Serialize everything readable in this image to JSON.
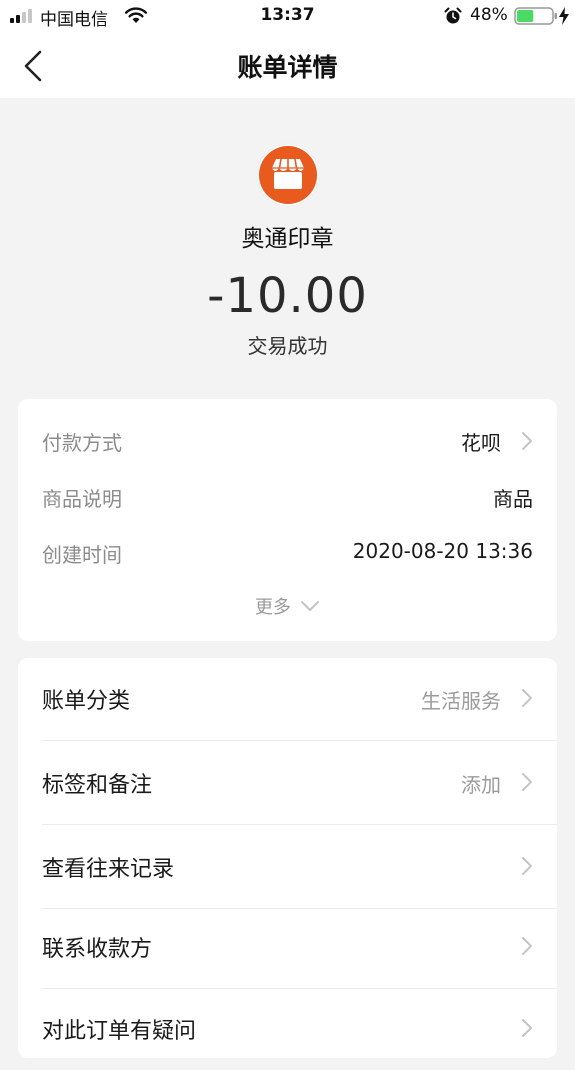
{
  "status_bar": {
    "carrier": "中国电信",
    "time": "13:37",
    "battery_percent": "48%",
    "battery_level": 0.48
  },
  "nav": {
    "back_icon": "chevron-left-icon",
    "title": "账单详情"
  },
  "merchant": {
    "name": "奥通印章",
    "icon": "store-icon",
    "brand_color": "#e85a1e"
  },
  "transaction": {
    "amount": "-10.00",
    "status": "交易成功"
  },
  "details": {
    "payment_method": {
      "label": "付款方式",
      "value": "花呗"
    },
    "description": {
      "label": "商品说明",
      "value": "商品"
    },
    "created_time": {
      "label": "创建时间",
      "value": "2020-08-20 13:36"
    },
    "more_label": "更多"
  },
  "actions": [
    {
      "label": "账单分类",
      "value": "生活服务"
    },
    {
      "label": "标签和备注",
      "value": "添加"
    },
    {
      "label": "查看往来记录",
      "value": ""
    },
    {
      "label": "联系收款方",
      "value": ""
    },
    {
      "label": "对此订单有疑问",
      "value": ""
    }
  ],
  "colors": {
    "battery_fill": "#4cd964",
    "background": "#f3f3f3"
  }
}
